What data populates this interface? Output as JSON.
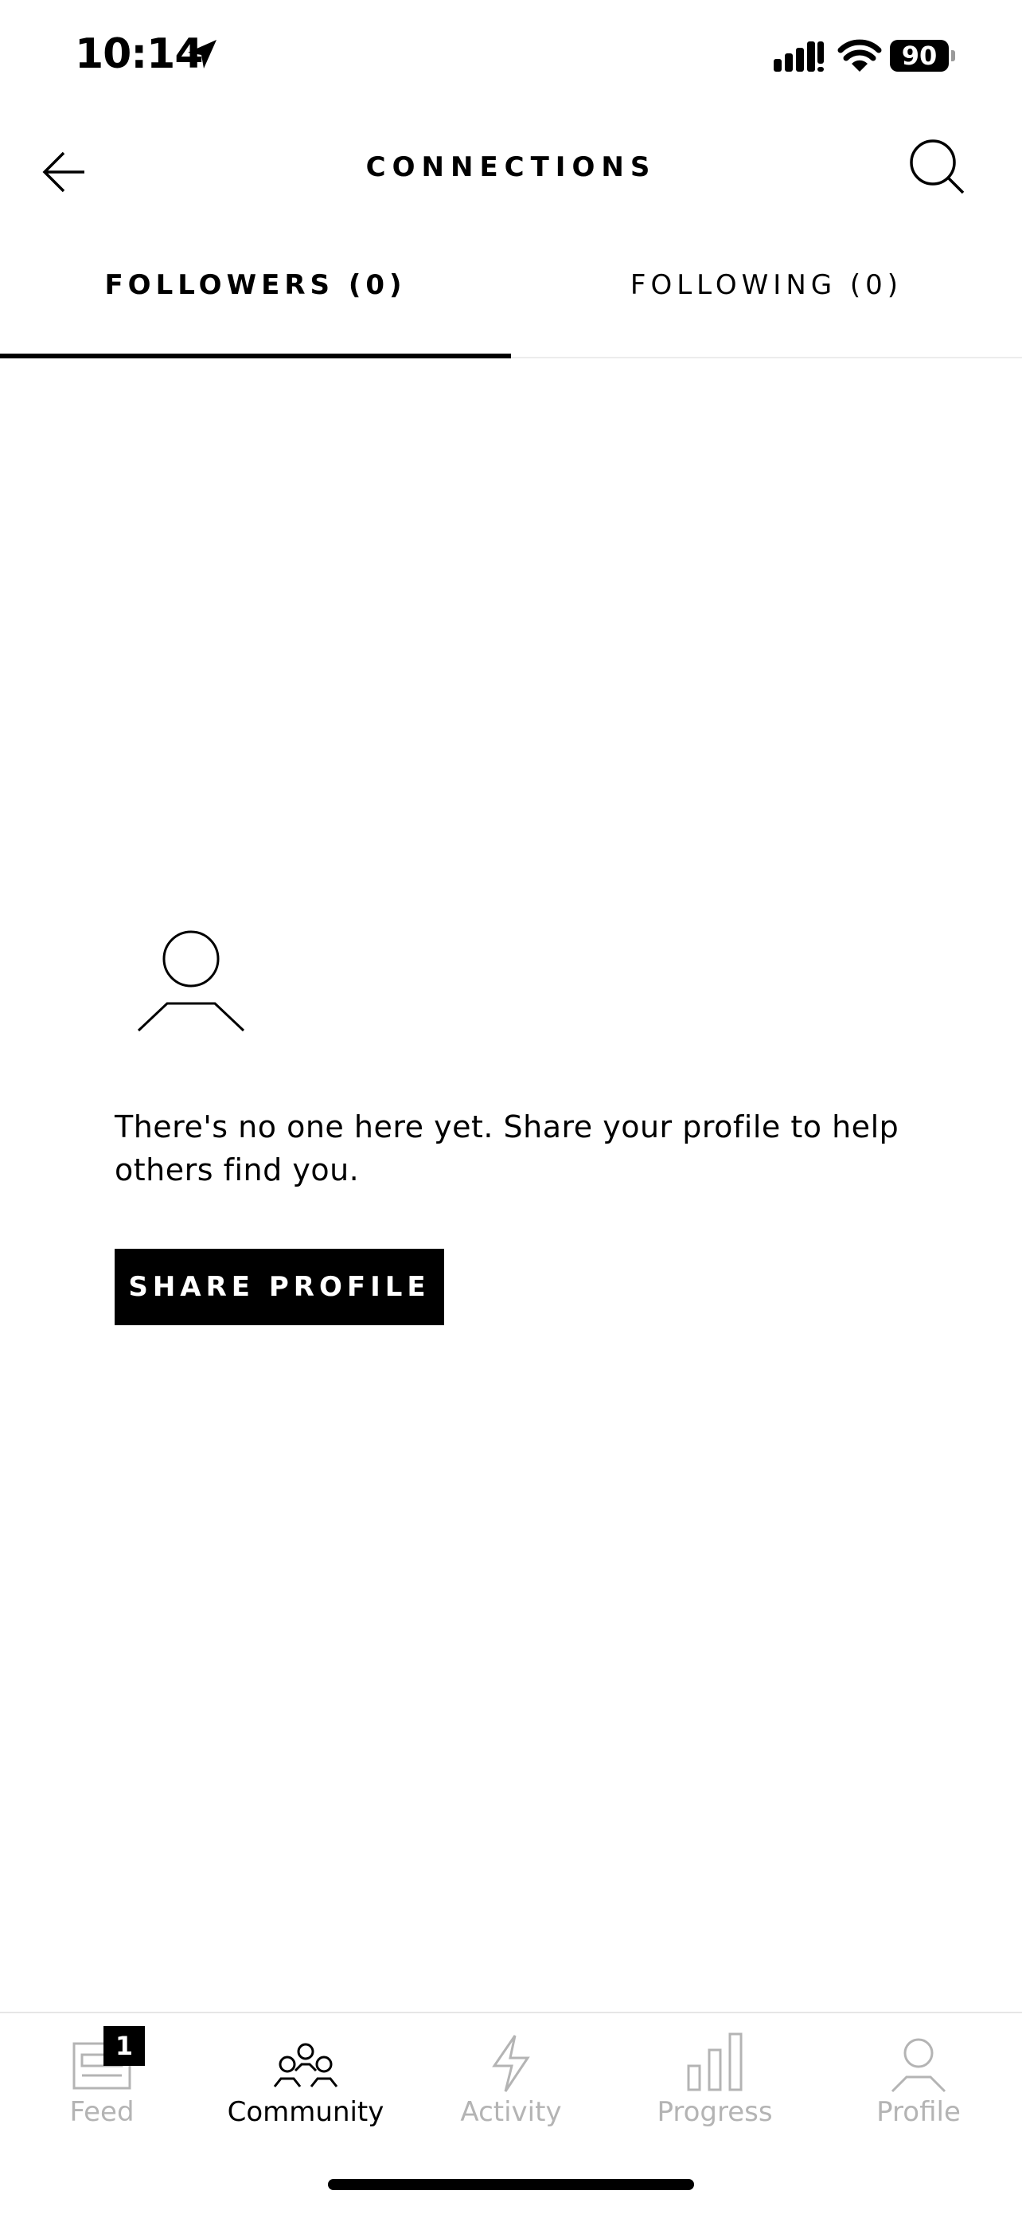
{
  "status_bar": {
    "time": "10:14",
    "battery": "90",
    "icons": [
      "location-arrow-icon",
      "signal-icon",
      "wifi-icon",
      "battery-icon"
    ]
  },
  "header": {
    "title": "CONNECTIONS",
    "back_icon": "arrow-left-icon",
    "search_icon": "search-icon"
  },
  "tabs": [
    {
      "label": "FOLLOWERS (0)",
      "active": true
    },
    {
      "label": "FOLLOWING (0)",
      "active": false
    }
  ],
  "empty_state": {
    "icon": "person-outline-icon",
    "message": "There's no one here yet. Share your profile to help others find you.",
    "button_label": "SHARE PROFILE"
  },
  "bottom_nav": {
    "items": [
      {
        "label": "Feed",
        "icon": "feed-icon",
        "badge": "1",
        "active": false
      },
      {
        "label": "Community",
        "icon": "community-icon",
        "active": true
      },
      {
        "label": "Activity",
        "icon": "activity-bolt-icon",
        "active": false
      },
      {
        "label": "Progress",
        "icon": "progress-bars-icon",
        "active": false
      },
      {
        "label": "Profile",
        "icon": "profile-person-icon",
        "active": false
      }
    ]
  },
  "colors": {
    "accent": "#000000",
    "inactive": "#b4b4b4",
    "divider": "#e6e6e6",
    "background": "#ffffff"
  }
}
